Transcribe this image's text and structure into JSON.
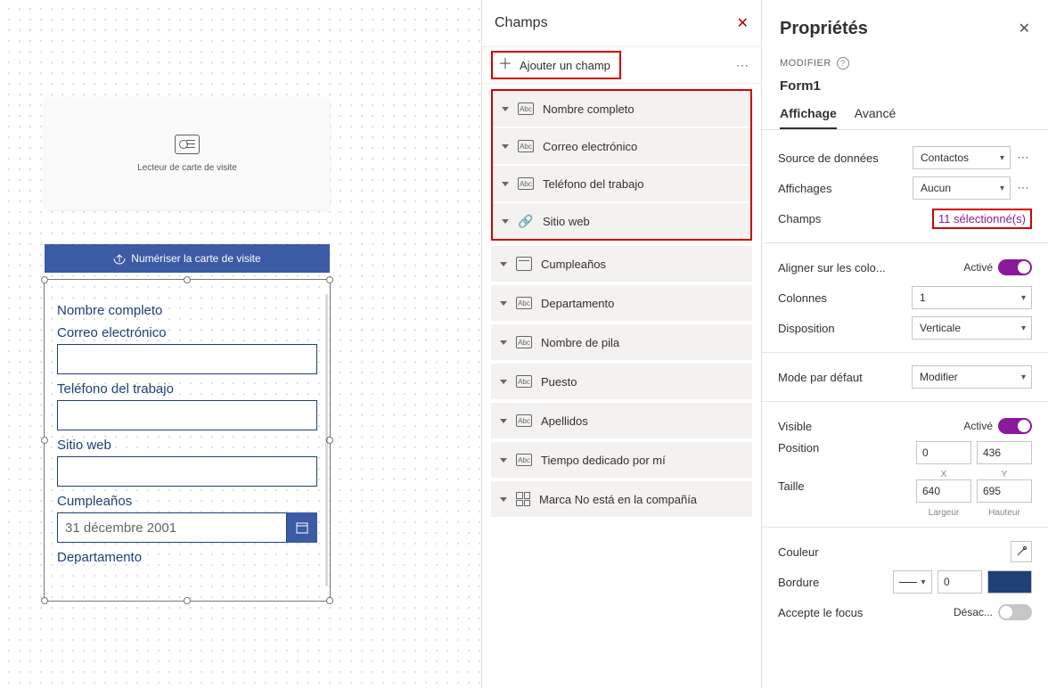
{
  "canvas": {
    "card_reader_label": "Lecteur de carte de visite",
    "scan_button": "Numériser la carte de visite"
  },
  "form_fields": {
    "f1": "Nombre completo",
    "f2": "Correo electrónico",
    "f3": "Teléfono del trabajo",
    "f4": "Sitio web",
    "f5": "Cumpleaños",
    "f5_value": "31 décembre 2001",
    "f6": "Departamento"
  },
  "fields_panel": {
    "title": "Champs",
    "add_field": "Ajouter un champ",
    "items": [
      "Nombre completo",
      "Correo electrónico",
      "Teléfono del trabajo",
      "Sitio web",
      "Cumpleaños",
      "Departamento",
      "Nombre de pila",
      "Puesto",
      "Apellidos",
      "Tiempo dedicado por mí",
      "Marca No está en la compañía"
    ]
  },
  "props": {
    "title": "Propriétés",
    "modifier": "MODIFIER",
    "object": "Form1",
    "tab_display": "Affichage",
    "tab_advanced": "Avancé",
    "data_source_label": "Source de données",
    "data_source_value": "Contactos",
    "views_label": "Affichages",
    "views_value": "Aucun",
    "fields_label": "Champs",
    "fields_link": "11 sélectionné(s)",
    "align_cols_label": "Aligner sur les colo...",
    "align_cols_state": "Activé",
    "cols_label": "Colonnes",
    "cols_value": "1",
    "layout_label": "Disposition",
    "layout_value": "Verticale",
    "mode_label": "Mode par défaut",
    "mode_value": "Modifier",
    "visible_label": "Visible",
    "visible_state": "Activé",
    "pos_label": "Position",
    "pos_x": "0",
    "pos_y": "436",
    "pos_x_cap": "X",
    "pos_y_cap": "Y",
    "size_label": "Taille",
    "size_w": "640",
    "size_h": "695",
    "size_w_cap": "Largeur",
    "size_h_cap": "Hauteur",
    "color_label": "Couleur",
    "border_label": "Bordure",
    "border_width": "0",
    "focus_label": "Accepte le focus",
    "focus_state": "Désac..."
  }
}
